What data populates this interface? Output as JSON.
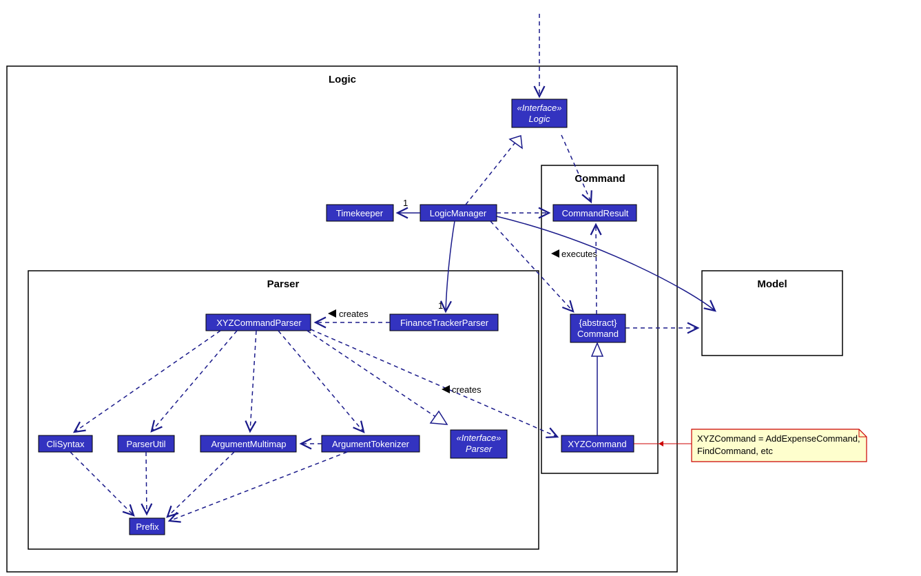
{
  "diagram_type": "UML Class Diagram",
  "packages": {
    "logic": "Logic",
    "parser": "Parser",
    "command": "Command",
    "model": "Model"
  },
  "classes": {
    "interface_logic_stereo": "«Interface»",
    "interface_logic": "Logic",
    "timekeeper": "Timekeeper",
    "logic_manager": "LogicManager",
    "command_result": "CommandResult",
    "abstract_stereo": "{abstract}",
    "abstract_command": "Command",
    "xyz_command": "XYZCommand",
    "xyz_cmd_parser": "XYZCommandParser",
    "finance_parser": "FinanceTrackerParser",
    "interface_parser_stereo": "«Interface»",
    "interface_parser": "Parser",
    "cli_syntax": "CliSyntax",
    "parser_util": "ParserUtil",
    "arg_multimap": "ArgumentMultimap",
    "arg_tokenizer": "ArgumentTokenizer",
    "prefix": "Prefix"
  },
  "labels": {
    "creates1": "creates",
    "creates2": "creates",
    "executes": "executes",
    "mult1a": "1",
    "mult1b": "1"
  },
  "note": {
    "line1": "XYZCommand = AddExpenseCommand,",
    "line2": "FindCommand, etc"
  }
}
